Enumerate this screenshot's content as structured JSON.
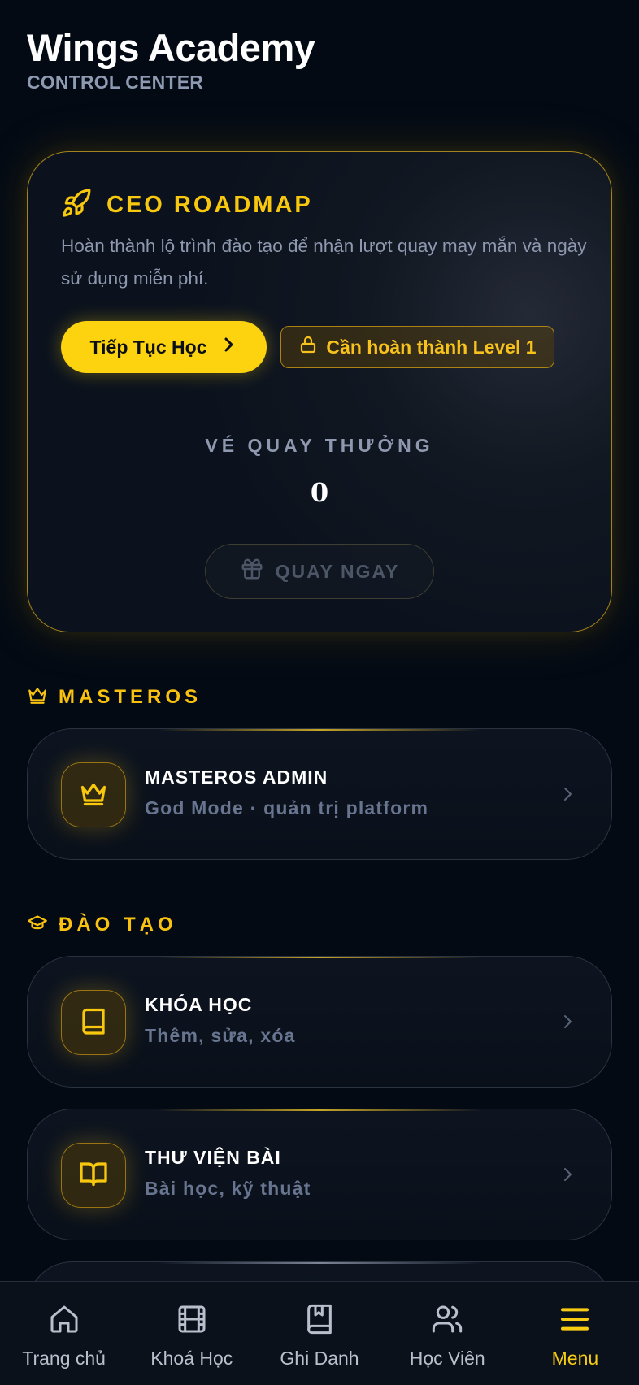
{
  "header": {
    "app_title": "Wings Academy",
    "subtitle": "CONTROL CENTER"
  },
  "roadmap": {
    "icon": "rocket-icon",
    "title": "CEO ROADMAP",
    "description": "Hoàn thành lộ trình đào tạo để nhận lượt quay may mắn và ngày sử dụng miễn phí.",
    "continue_label": "Tiếp Tục Học",
    "lock_label": "Cần hoàn thành Level 1",
    "tickets_label": "VÉ QUAY THƯỞNG",
    "tickets_count": "0",
    "spin_label": "QUAY NGAY"
  },
  "sections": {
    "masteros": {
      "title": "MASTEROS",
      "icon": "crown-icon",
      "items": [
        {
          "title": "MASTEROS ADMIN",
          "subtitle": "God Mode · quản trị platform",
          "icon": "crown-icon"
        }
      ]
    },
    "training": {
      "title": "ĐÀO TẠO",
      "icon": "graduation-cap-icon",
      "items": [
        {
          "title": "KHÓA HỌC",
          "subtitle": "Thêm, sửa, xóa",
          "icon": "book-icon"
        },
        {
          "title": "THƯ VIỆN BÀI",
          "subtitle": "Bài học, kỹ thuật",
          "icon": "open-book-icon"
        }
      ]
    }
  },
  "bottom_nav": [
    {
      "label": "Trang chủ",
      "icon": "home-icon"
    },
    {
      "label": "Khoá Học",
      "icon": "film-icon"
    },
    {
      "label": "Ghi Danh",
      "icon": "bookmark-book-icon"
    },
    {
      "label": "Học Viên",
      "icon": "users-icon"
    },
    {
      "label": "Menu",
      "icon": "menu-icon",
      "active": true
    }
  ],
  "colors": {
    "background": "#030a14",
    "accent": "#f8c80f",
    "button_yellow": "#fdd20f",
    "muted_text": "#8e99b0",
    "card_border": "#d6aa1e"
  }
}
